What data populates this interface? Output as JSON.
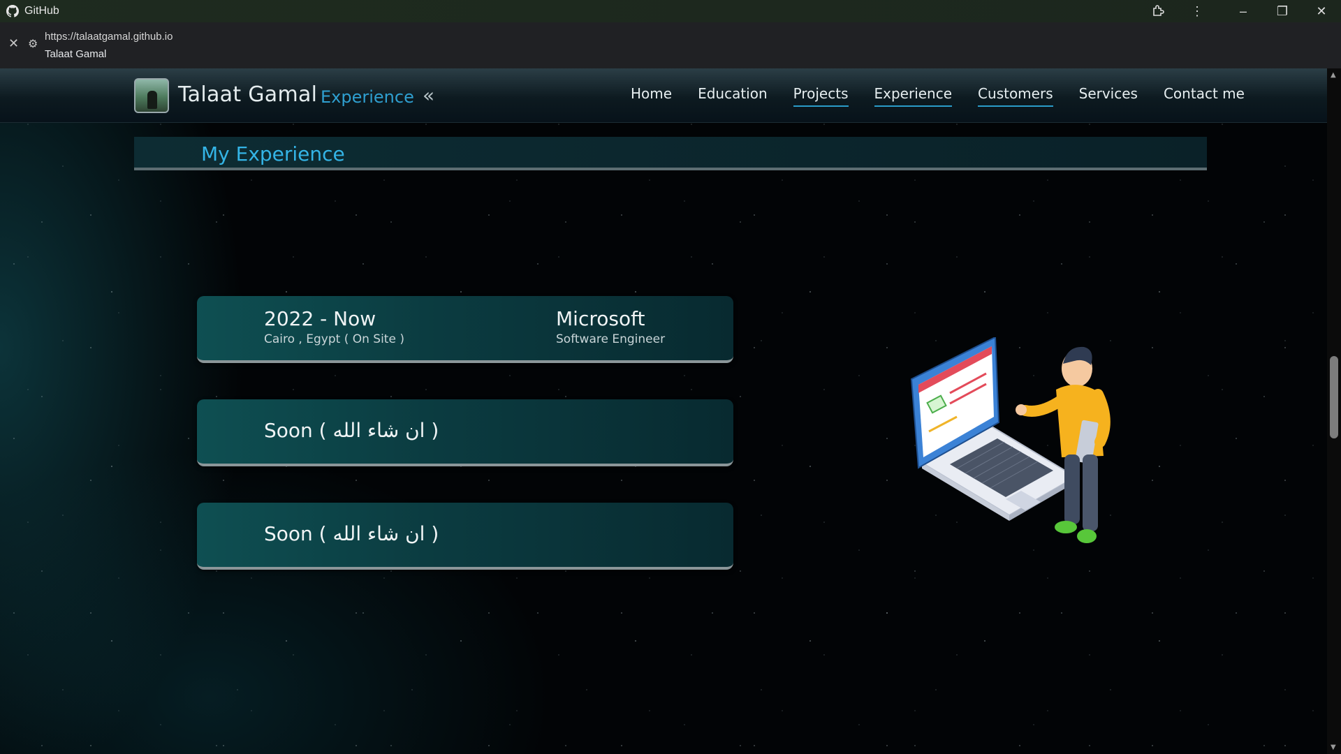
{
  "window": {
    "app_name": "GitHub",
    "icons": [
      "github-icon",
      "extensions-icon",
      "more-icon",
      "minimize-icon",
      "maximize-icon",
      "close-icon"
    ]
  },
  "addressbar": {
    "url": "https://talaatgamal.github.io",
    "page_title": "Talaat Gamal"
  },
  "site": {
    "brand": "Talaat Gamal",
    "section_label": "Experience",
    "nav": {
      "home": "Home",
      "education": "Education",
      "projects": "Projects",
      "experience": "Experience",
      "customers": "Customers",
      "services": "Services",
      "contact": "Contact me"
    }
  },
  "section": {
    "title": "My Experience"
  },
  "experience": [
    {
      "period": "2022 - Now",
      "location": "Cairo , Egypt ( On Site )",
      "company": "Microsoft",
      "role": "Software Engineer"
    },
    {
      "placeholder": "Soon ( ان شاء الله )"
    },
    {
      "placeholder": "Soon ( ان شاء الله )"
    }
  ],
  "colors": {
    "accent": "#2a9cc9",
    "heading": "#34b4e6",
    "card": "#0e4f52"
  }
}
